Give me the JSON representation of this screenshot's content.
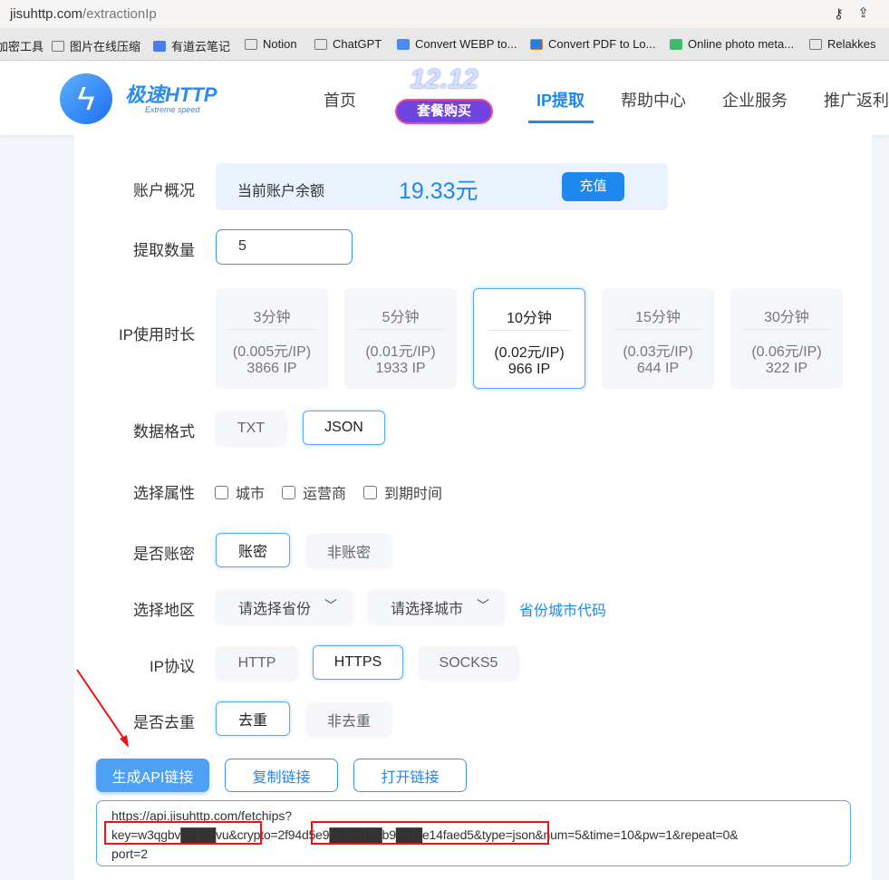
{
  "browser": {
    "url_host": "jisuhttp.com",
    "url_path": "/extractionIp",
    "bookmarks": [
      "加密工具",
      "图片在线压缩",
      "有道云笔记",
      "Notion",
      "ChatGPT",
      "Convert WEBP to...",
      "Convert PDF to Lo...",
      "Online photo meta...",
      "Relakkes"
    ]
  },
  "header": {
    "logo": "极速HTTP",
    "logo_sub": "Extreme speed",
    "promo_title": "12.12",
    "promo_label": "套餐购买",
    "nav": [
      "首页",
      "IP提取",
      "帮助中心",
      "企业服务",
      "推广返利"
    ],
    "active_nav": "IP提取"
  },
  "form": {
    "account": {
      "label": "账户概况",
      "balance_label": "当前账户余额",
      "balance": "19.33元",
      "recharge": "充值"
    },
    "quantity": {
      "label": "提取数量",
      "value": "5"
    },
    "duration": {
      "label": "IP使用时长",
      "options": [
        {
          "time": "3分钟",
          "price": "(0.005元/IP)",
          "count": "3866 IP"
        },
        {
          "time": "5分钟",
          "price": "(0.01元/IP)",
          "count": "1933 IP"
        },
        {
          "time": "10分钟",
          "price": "(0.02元/IP)",
          "count": "966 IP"
        },
        {
          "time": "15分钟",
          "price": "(0.03元/IP)",
          "count": "644 IP"
        },
        {
          "time": "30分钟",
          "price": "(0.06元/IP)",
          "count": "322 IP"
        }
      ],
      "selected": "10分钟"
    },
    "format": {
      "label": "数据格式",
      "options": [
        "TXT",
        "JSON"
      ],
      "selected": "JSON"
    },
    "attributes": {
      "label": "选择属性",
      "options": [
        "城市",
        "运营商",
        "到期时间"
      ]
    },
    "auth": {
      "label": "是否账密",
      "options": [
        "账密",
        "非账密"
      ],
      "selected": "账密"
    },
    "region": {
      "label": "选择地区",
      "province_placeholder": "请选择省份",
      "city_placeholder": "请选择城市",
      "code_link": "省份城市代码"
    },
    "protocol": {
      "label": "IP协议",
      "options": [
        "HTTP",
        "HTTPS",
        "SOCKS5"
      ],
      "selected": "HTTPS"
    },
    "dedupe": {
      "label": "是否去重",
      "options": [
        "去重",
        "非去重"
      ],
      "selected": "去重"
    },
    "actions": {
      "generate": "生成API链接",
      "copy": "复制链接",
      "open": "打开链接"
    },
    "api_url": {
      "line1": "https://api.jisuhttp.com/fetchips?",
      "key": "key=w3qgbv████vu",
      "mid": "&crypto=",
      "crypto": "2f94d5e9██████b9███e14faed5",
      "rest": "&type=json&num=5&time=10&pw=1&repeat=0&",
      "line3": "port=2"
    }
  },
  "colors": {
    "accent": "#1e88f0",
    "annotation": "#e11"
  }
}
